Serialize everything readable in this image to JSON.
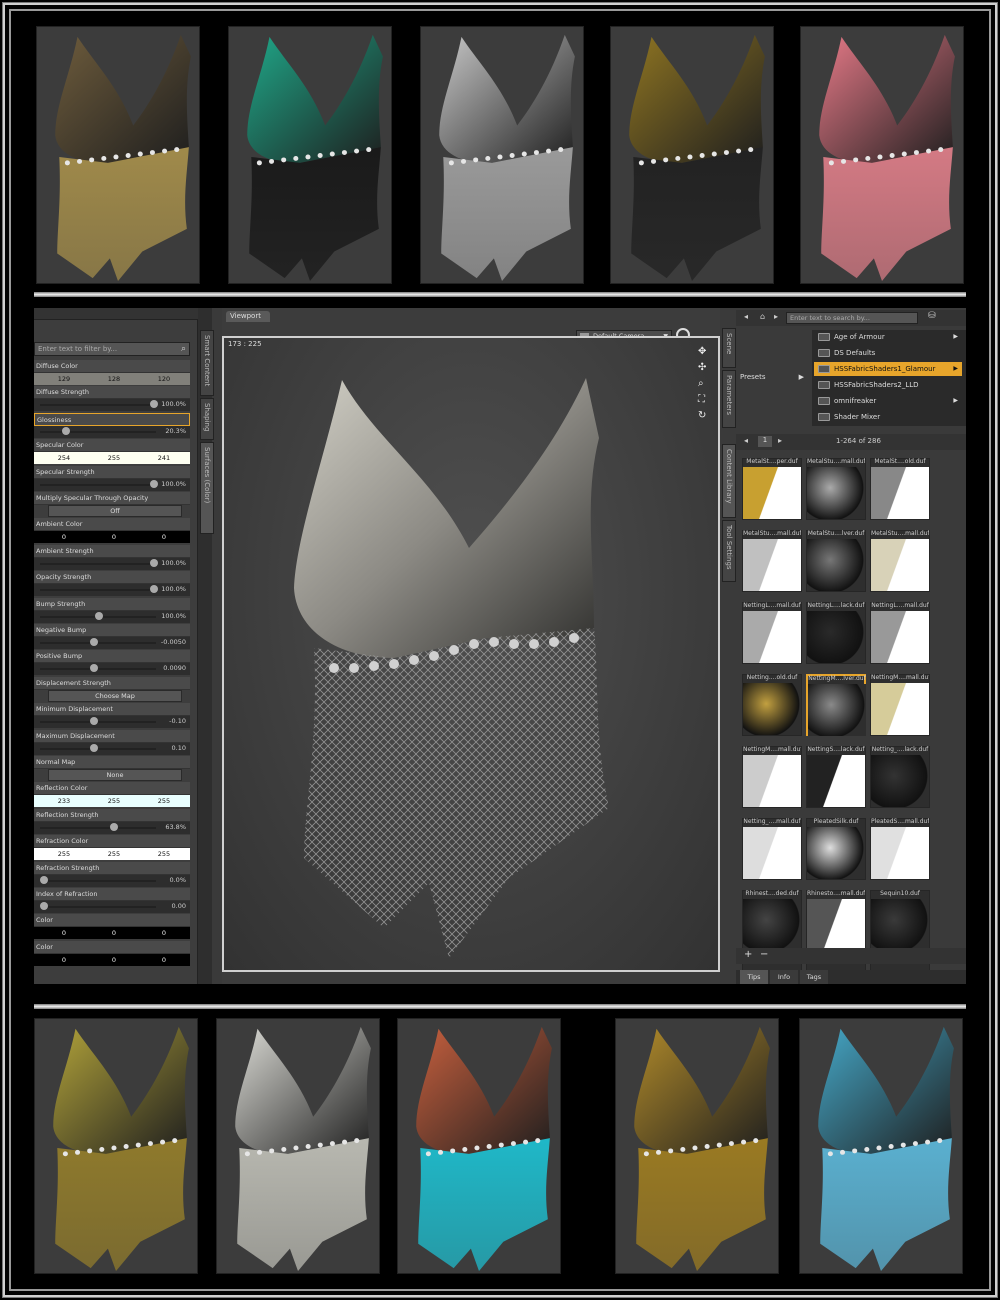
{
  "viewport": {
    "tab": "Viewport",
    "coords": "173 : 225",
    "camera": "Default Camera"
  },
  "left_panel": {
    "filter_placeholder": "Enter text to filter by...",
    "tabs": [
      "Smart Content",
      "Shaping",
      "Surfaces (Color)"
    ],
    "props": [
      {
        "label": "Diffuse Color",
        "type": "color",
        "values": [
          "129",
          "128",
          "120"
        ],
        "swatch": "#81807a"
      },
      {
        "label": "Diffuse Strength",
        "type": "slider",
        "value": "100.0%",
        "pos": 1.0
      },
      {
        "label": "Glossiness",
        "type": "slider",
        "value": "20.3%",
        "pos": 0.2,
        "selected": true
      },
      {
        "label": "Specular Color",
        "type": "color",
        "values": [
          "254",
          "255",
          "241"
        ],
        "swatch": "#fefff1"
      },
      {
        "label": "Specular Strength",
        "type": "slider",
        "value": "100.0%",
        "pos": 1.0
      },
      {
        "label": "Multiply Specular Through Opacity",
        "type": "button",
        "value": "Off"
      },
      {
        "label": "Ambient Color",
        "type": "color",
        "values": [
          "0",
          "0",
          "0"
        ],
        "swatch": "#000000"
      },
      {
        "label": "Ambient Strength",
        "type": "slider",
        "value": "100.0%",
        "pos": 1.0
      },
      {
        "label": "Opacity Strength",
        "type": "slider",
        "value": "100.0%",
        "pos": 1.0
      },
      {
        "label": "Bump Strength",
        "type": "slider",
        "value": "100.0%",
        "pos": 0.5
      },
      {
        "label": "Negative Bump",
        "type": "slider",
        "value": "-0.0050",
        "pos": 0.45
      },
      {
        "label": "Positive Bump",
        "type": "slider",
        "value": "0.0090",
        "pos": 0.45
      },
      {
        "label": "Displacement Strength",
        "type": "button",
        "value": "Choose Map"
      },
      {
        "label": "Minimum Displacement",
        "type": "slider",
        "value": "-0.10",
        "pos": 0.45
      },
      {
        "label": "Maximum Displacement",
        "type": "slider",
        "value": "0.10",
        "pos": 0.45
      },
      {
        "label": "Normal Map",
        "type": "button",
        "value": "None"
      },
      {
        "label": "Reflection Color",
        "type": "color",
        "values": [
          "233",
          "255",
          "255"
        ],
        "swatch": "#e9ffff"
      },
      {
        "label": "Reflection Strength",
        "type": "slider",
        "value": "63.8%",
        "pos": 0.64
      },
      {
        "label": "Refraction Color",
        "type": "color",
        "values": [
          "255",
          "255",
          "255"
        ],
        "swatch": "#ffffff"
      },
      {
        "label": "Refraction Strength",
        "type": "slider",
        "value": "0.0%",
        "pos": 0.0
      },
      {
        "label": "Index of Refraction",
        "type": "slider",
        "value": "0.00",
        "pos": 0.0
      },
      {
        "label": "Color",
        "type": "color",
        "values": [
          "0",
          "0",
          "0"
        ],
        "swatch": "#000000"
      },
      {
        "label": "Color",
        "type": "color",
        "values": [
          "0",
          "0",
          "0"
        ],
        "swatch": "#000000"
      }
    ]
  },
  "right_panel": {
    "search_placeholder": "Enter text to search by...",
    "tabs": [
      "Scene",
      "Parameters",
      "Content Library",
      "Tool Settings"
    ],
    "presets_label": "Presets",
    "folders": [
      {
        "name": "Age of Armour",
        "arrow": true
      },
      {
        "name": "DS Defaults",
        "arrow": false
      },
      {
        "name": "HSSFabricShaders1_Glamour",
        "arrow": true,
        "selected": true
      },
      {
        "name": "HSSFabricShaders2_LLD",
        "arrow": false
      },
      {
        "name": "omnifreaker",
        "arrow": true
      },
      {
        "name": "Shader Mixer",
        "arrow": false
      }
    ],
    "page": "1",
    "count": "1-264 of 286",
    "tiles": [
      {
        "label": "MetalSt....per.duf",
        "kind": "strip",
        "color": "#c8a030"
      },
      {
        "label": "MetalStu....mall.duf",
        "kind": "sphere",
        "color": "#aaaaaa"
      },
      {
        "label": "MetalSt....old.duf",
        "kind": "strip",
        "color": "#888888"
      },
      {
        "label": "MetalStu....mall.duf",
        "kind": "strip",
        "color": "#c0c0c0"
      },
      {
        "label": "MetalStu....lver.duf",
        "kind": "sphere",
        "color": "#777777"
      },
      {
        "label": "MetalStu....mall.duf",
        "kind": "strip",
        "color": "#d8d2b8"
      },
      {
        "label": "NettingL....mall.duf",
        "kind": "strip",
        "color": "#aaaaaa"
      },
      {
        "label": "NettingL....lack.duf",
        "kind": "sphere",
        "color": "#2a2a2a"
      },
      {
        "label": "NettingL....mall.duf",
        "kind": "strip",
        "color": "#999999"
      },
      {
        "label": "Netting....old.duf",
        "kind": "sphere",
        "color": "#c2a040"
      },
      {
        "label": "NettingM....lver.duf",
        "kind": "sphere",
        "color": "#8a8a8a",
        "selected": true
      },
      {
        "label": "NettingM....mall.duf",
        "kind": "strip",
        "color": "#d6cc9a"
      },
      {
        "label": "NettingM....mall.duf",
        "kind": "strip",
        "color": "#cccccc"
      },
      {
        "label": "NettingS....lack.duf",
        "kind": "strip",
        "color": "#222222"
      },
      {
        "label": "Netting_....lack.duf",
        "kind": "sphere",
        "color": "#333333"
      },
      {
        "label": "Netting_....mall.duf",
        "kind": "strip",
        "color": "#dddddd"
      },
      {
        "label": "PleatedSilk.duf",
        "kind": "sphere",
        "color": "#dedede"
      },
      {
        "label": "PleatedS....mall.duf",
        "kind": "strip",
        "color": "#e0e0e0"
      },
      {
        "label": "Rhinest....ded.duf",
        "kind": "sphere",
        "color": "#444444"
      },
      {
        "label": "Rhinesto....mall.duf",
        "kind": "strip",
        "color": "#555555"
      },
      {
        "label": "Sequin10.duf",
        "kind": "sphere",
        "color": "#3a3a3a"
      },
      {
        "label": "",
        "kind": "strip",
        "color": "#eeeeee"
      },
      {
        "label": "",
        "kind": "sphere",
        "color": "#cccccc"
      },
      {
        "label": "",
        "kind": "strip",
        "color": "#e6e6e6"
      }
    ],
    "bottom_tabs": [
      "Tips",
      "Info",
      "Tags"
    ]
  },
  "top_renders": [
    {
      "top": "#6e5c3c",
      "bottom": "#a08a4a"
    },
    {
      "top": "#1fa889",
      "bottom": "#1a1a1a"
    },
    {
      "top": "#c8c8c8",
      "bottom": "#9a9a9a"
    },
    {
      "top": "#8f7522",
      "bottom": "#222222"
    },
    {
      "top": "#e77a88",
      "bottom": "#d47a84"
    }
  ],
  "bottom_renders": [
    {
      "top": "#b2a33a",
      "bottom": "#8f7a2c"
    },
    {
      "top": "#dcdcd6",
      "bottom": "#b8b8b0"
    },
    {
      "top": "#c8603e",
      "bottom": "#1fb8c8"
    },
    {
      "top": "#b08a2a",
      "bottom": "#9a7a22"
    },
    {
      "top": "#45a8c8",
      "bottom": "#5ab0d0"
    }
  ]
}
